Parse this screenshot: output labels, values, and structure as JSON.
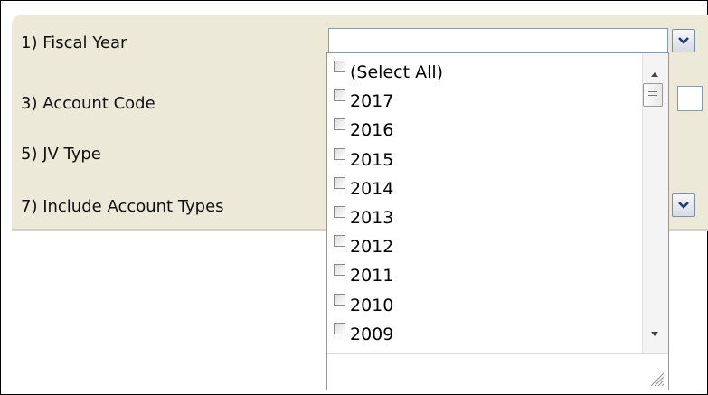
{
  "parameters": {
    "fiscal_year_label": "1) Fiscal Year",
    "fiscal_year_value": "",
    "account_code_label": "3) Account Code",
    "jv_type_label": "5) JV Type",
    "include_account_types_label": "7) Include Account Types"
  },
  "dropdown": {
    "options": [
      {
        "label": "(Select All)",
        "checked": false
      },
      {
        "label": "2017",
        "checked": false
      },
      {
        "label": "2016",
        "checked": false
      },
      {
        "label": "2015",
        "checked": false
      },
      {
        "label": "2014",
        "checked": false
      },
      {
        "label": "2013",
        "checked": false
      },
      {
        "label": "2012",
        "checked": false
      },
      {
        "label": "2011",
        "checked": false
      },
      {
        "label": "2010",
        "checked": false
      },
      {
        "label": "2009",
        "checked": false
      }
    ]
  },
  "icons": {
    "dropdown_arrow": "chevron-down-icon",
    "scroll_up": "scroll-up-arrow-icon",
    "scroll_down": "scroll-down-arrow-icon",
    "resize": "resize-grip-icon"
  },
  "colors": {
    "panel_background": "#ece9d8",
    "field_border": "#7f9db9"
  }
}
